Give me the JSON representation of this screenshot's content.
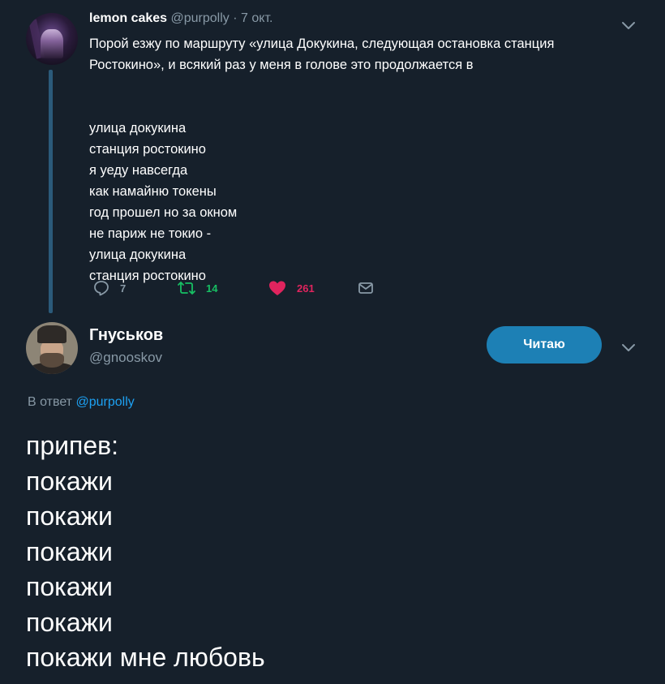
{
  "parent_tweet": {
    "author_name": "lemon cakes",
    "author_handle": "@purpolly",
    "separator": "·",
    "date": "7 окт.",
    "text_intro": [
      "Порой езжу по маршруту «улица Докукина, следующая остановка станция",
      "Ростокино», и всякий раз у меня в голове это продолжается в"
    ],
    "text_poem": [
      "улица докукина",
      "станция ростокино",
      "я уеду навсегда",
      "как намайню токены",
      "год прошел но за окном",
      "не париж не токио -",
      "улица докукина",
      "станция ростокино"
    ],
    "actions": {
      "reply_count": "7",
      "retweet_count": "14",
      "like_count": "261"
    }
  },
  "reply_tweet": {
    "author_name": "Гнуськов",
    "author_handle": "@gnooskov",
    "follow_label": "Читаю",
    "reply_prefix": "В ответ",
    "reply_mention": "@purpolly",
    "text_lines": [
      "припев:",
      "покажи",
      "покажи",
      "покажи",
      "покажи",
      "покажи",
      "покажи мне любовь"
    ]
  },
  "colors": {
    "background": "#16202b",
    "secondary_text": "#8899a6",
    "accent": "#1da1f2",
    "retweet": "#17bf63",
    "like": "#e0245e",
    "follow_button": "#1d80b5",
    "thread_line": "#2b5a7a"
  },
  "icons": {
    "reply": "reply-icon",
    "retweet": "retweet-icon",
    "like": "heart-icon",
    "dm": "envelope-icon",
    "menu": "chevron-down-icon"
  }
}
